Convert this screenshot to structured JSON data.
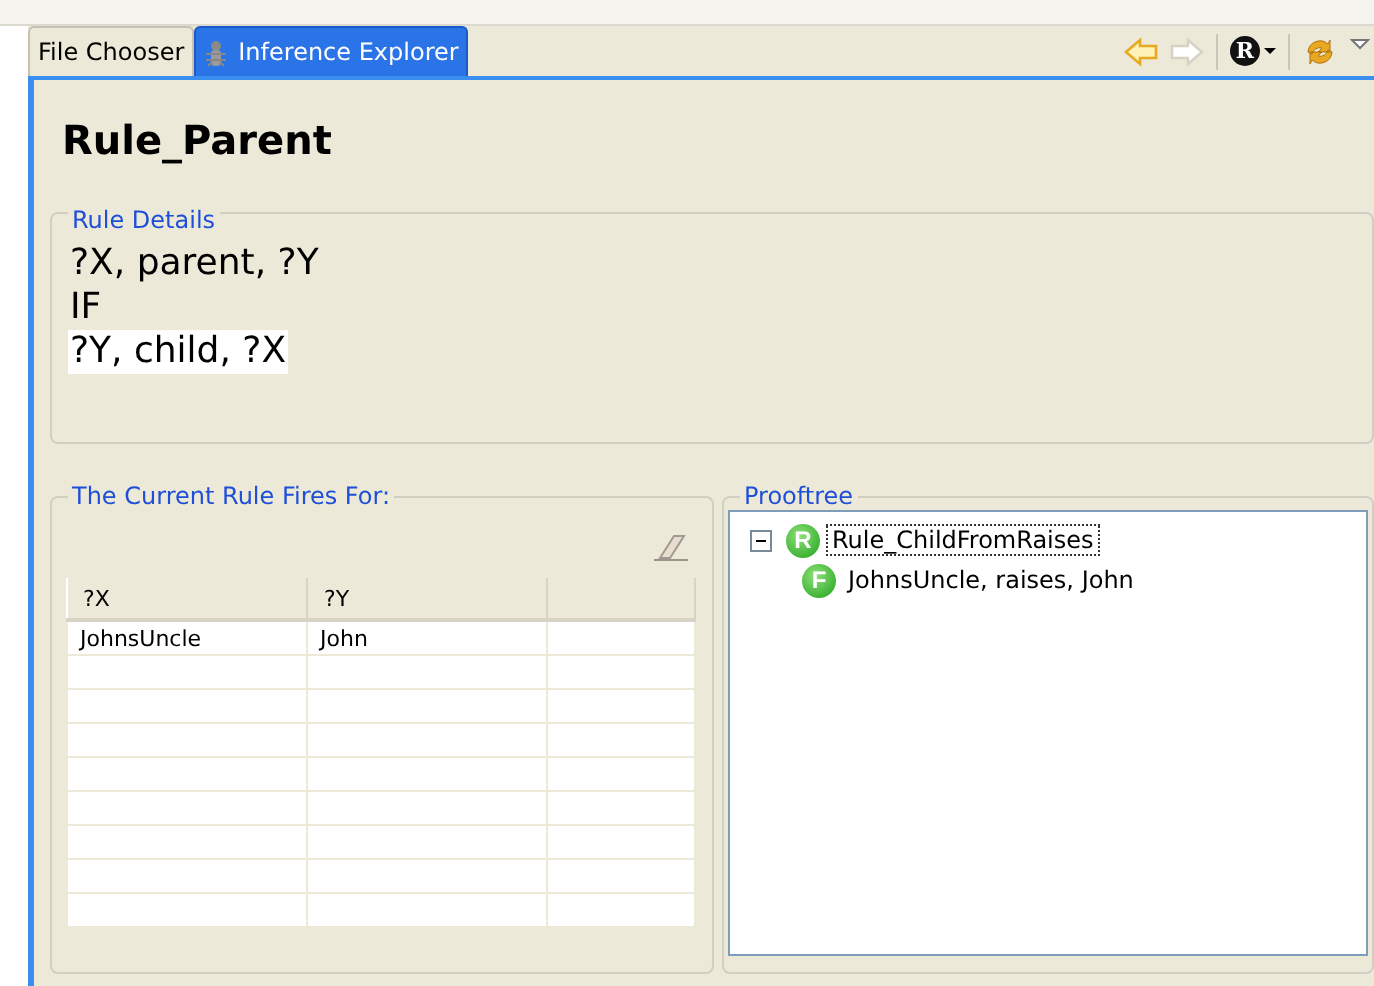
{
  "tabs": [
    {
      "label": "File Chooser",
      "selected": false
    },
    {
      "label": "Inference Explorer",
      "selected": true
    }
  ],
  "toolbar": [
    {
      "kind": "back",
      "disabled": false
    },
    {
      "kind": "forward",
      "disabled": true
    },
    {
      "kind": "badge-menu",
      "badge": "R"
    },
    {
      "kind": "sync",
      "disabled": false
    },
    {
      "kind": "view-menu"
    }
  ],
  "title": "Rule_Parent",
  "rule_details": {
    "label": "Rule Details",
    "lines": [
      {
        "text": "?X, parent, ?Y",
        "highlighted": false
      },
      {
        "text": "IF",
        "highlighted": false
      },
      {
        "text": "?Y, child, ?X",
        "highlighted": true
      }
    ]
  },
  "fires_for": {
    "label": "The Current Rule Fires For:",
    "table": {
      "columns": [
        "?X",
        "?Y"
      ],
      "rows": [
        [
          "JohnsUncle",
          "John"
        ]
      ]
    }
  },
  "prooftree": {
    "label": "Prooftree",
    "items": [
      {
        "badge": "R",
        "label": "Rule_ChildFromRaises",
        "expanded": true,
        "focused": true,
        "children": [
          {
            "badge": "F",
            "label": "JohnsUncle, raises, John",
            "focused": false
          }
        ]
      }
    ]
  }
}
